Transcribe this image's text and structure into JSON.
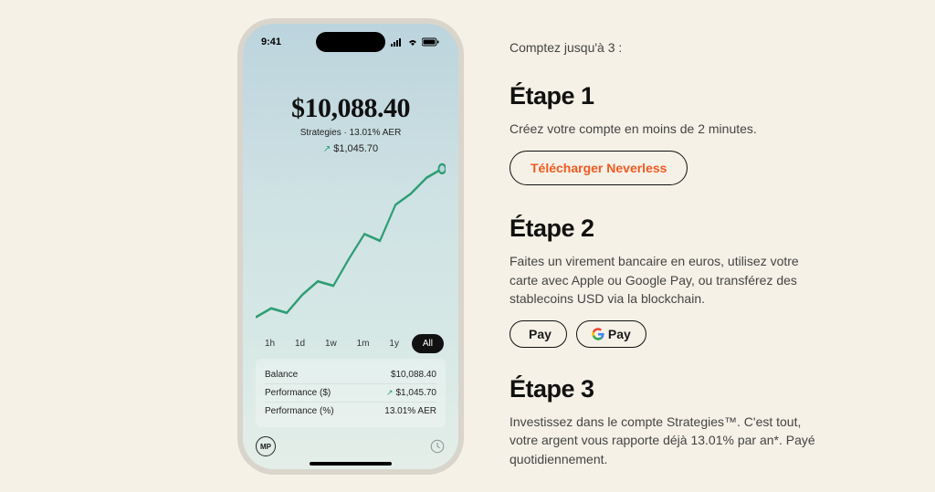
{
  "phone": {
    "status": {
      "time": "9:41"
    },
    "hero": {
      "amount": "$10,088.40",
      "subtitle": "Strategies · 13.01% AER",
      "gain": "$1,045.70"
    },
    "chips": {
      "h1": "1h",
      "d1": "1d",
      "w1": "1w",
      "m1": "1m",
      "y1": "1y",
      "all": "All"
    },
    "stats": {
      "balance_label": "Balance",
      "balance_value": "$10,088.40",
      "perf_usd_label": "Performance ($)",
      "perf_usd_value": "$1,045.70",
      "perf_pct_label": "Performance (%)",
      "perf_pct_value": "13.01% AER"
    },
    "avatar": "MP"
  },
  "right": {
    "lead": "Comptez jusqu'à 3 :",
    "step1": {
      "title": "Étape 1",
      "body": "Créez votre compte en moins de 2 minutes.",
      "cta": "Télécharger Neverless"
    },
    "step2": {
      "title": "Étape 2",
      "body": "Faites un virement bancaire en euros, utilisez votre carte avec Apple ou Google Pay, ou transférez des stablecoins USD via la blockchain.",
      "apple_pay": "Pay",
      "google_pay": "Pay"
    },
    "step3": {
      "title": "Étape 3",
      "body": "Investissez dans le compte Strategies™. C'est tout, votre argent vous rapporte déjà 13.01% par an*. Payé quotidiennement."
    }
  },
  "chart_data": {
    "type": "line",
    "title": "",
    "xlabel": "",
    "ylabel": "",
    "x": [
      0,
      1,
      2,
      3,
      4,
      5,
      6,
      7,
      8,
      9,
      10,
      11,
      12
    ],
    "values": [
      9100,
      9160,
      9130,
      9250,
      9340,
      9300,
      9480,
      9650,
      9600,
      9820,
      9900,
      10020,
      10088
    ],
    "ylim": [
      9000,
      10200
    ],
    "selected_range": "All"
  }
}
